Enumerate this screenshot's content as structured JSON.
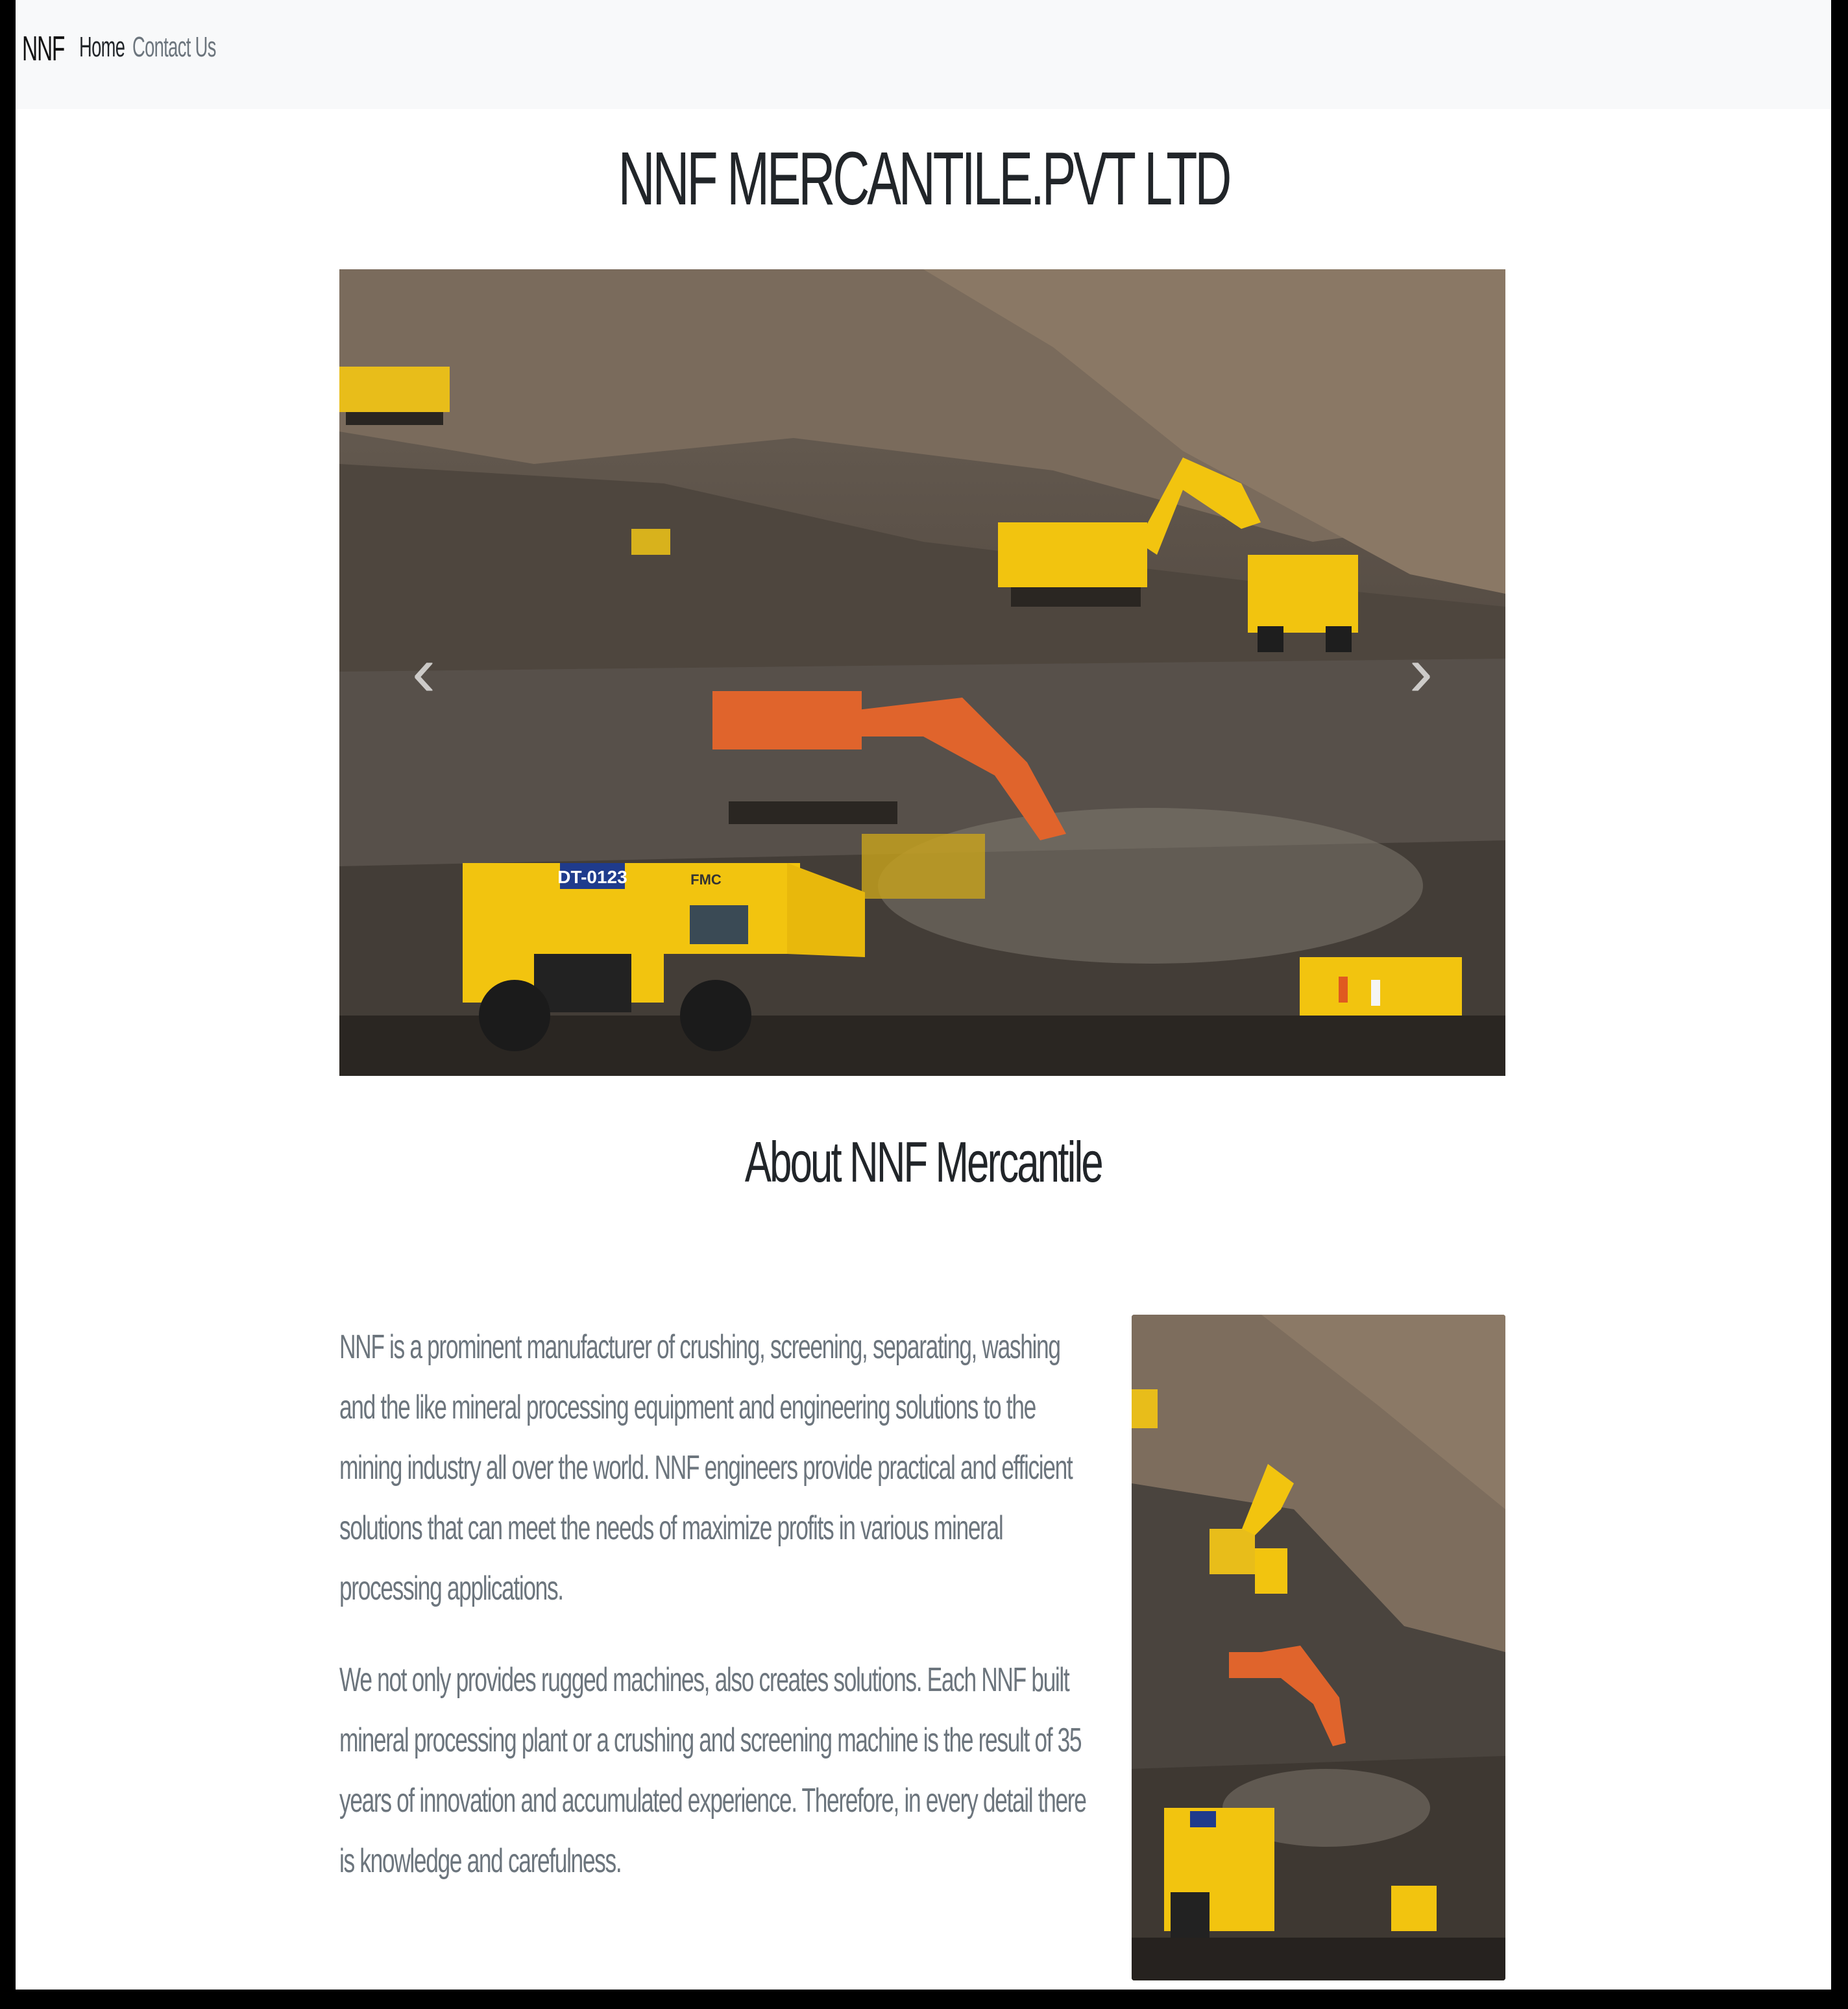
{
  "navbar": {
    "brand": "NNF",
    "links": [
      {
        "label": "Home",
        "active": true
      },
      {
        "label": "Contact Us",
        "active": false
      }
    ]
  },
  "header": {
    "title": "NNF MERCANTILE.PVT LTD"
  },
  "carousel": {
    "prev_icon": "chevron-left-icon",
    "next_icon": "chevron-right-icon",
    "prev_glyph": "‹",
    "next_glyph": "›",
    "image_labels": [
      "DT-0123",
      "FMC"
    ]
  },
  "about": {
    "heading": "About NNF Mercantile",
    "paragraphs": [
      "NNF is a prominent manufacturer of crushing, screening, separating, washing and the like mineral processing equipment and engineering solutions to the mining industry all over the world. NNF engineers provide practical and efficient solutions that can meet the needs of maximize profits in various mineral processing applications.",
      "We not only provides rugged machines, also creates solutions. Each NNF built mineral processing plant or a crushing and screening machine is the result of 35 years of innovation and accumulated experience. Therefore, in every detail there is knowledge and carefulness."
    ]
  },
  "colors": {
    "navbar_bg": "#f8f9fa",
    "text_primary": "#212529",
    "text_muted": "#6c757d",
    "machine_yellow": "#f2c40f",
    "machine_orange": "#e0642c"
  }
}
